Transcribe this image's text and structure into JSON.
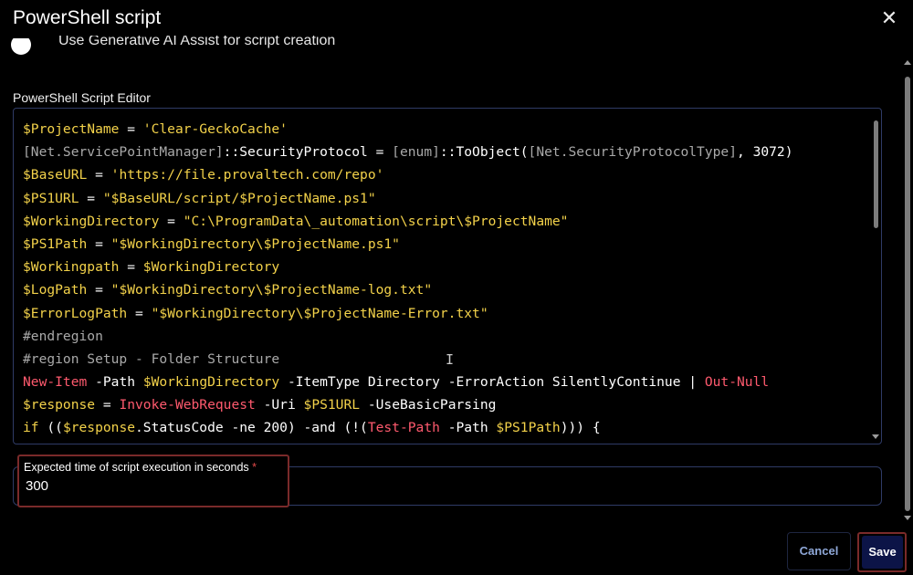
{
  "dialog": {
    "title": "PowerShell script",
    "close_icon": "close-icon"
  },
  "ai_assist": {
    "label": "Use Generative AI Assist for script creation"
  },
  "editor": {
    "label": "PowerShell Script Editor",
    "lines": [
      [
        {
          "c": "v",
          "t": "$ProjectName"
        },
        {
          "c": "p",
          "t": " = "
        },
        {
          "c": "s",
          "t": "'Clear-GeckoCache'"
        }
      ],
      [
        {
          "c": "t",
          "t": "[Net.ServicePointManager]"
        },
        {
          "c": "p",
          "t": "::SecurityProtocol = "
        },
        {
          "c": "t",
          "t": "[enum]"
        },
        {
          "c": "p",
          "t": "::ToObject("
        },
        {
          "c": "t",
          "t": "[Net.SecurityProtocolType]"
        },
        {
          "c": "p",
          "t": ", 3072)"
        }
      ],
      [
        {
          "c": "v",
          "t": "$BaseURL"
        },
        {
          "c": "p",
          "t": " = "
        },
        {
          "c": "s",
          "t": "'https://file.provaltech.com/repo'"
        }
      ],
      [
        {
          "c": "v",
          "t": "$PS1URL"
        },
        {
          "c": "p",
          "t": " = "
        },
        {
          "c": "s",
          "t": "\"$BaseURL/script/$ProjectName.ps1\""
        }
      ],
      [
        {
          "c": "v",
          "t": "$WorkingDirectory"
        },
        {
          "c": "p",
          "t": " = "
        },
        {
          "c": "s",
          "t": "\"C:\\ProgramData\\_automation\\script\\$ProjectName\""
        }
      ],
      [
        {
          "c": "v",
          "t": "$PS1Path"
        },
        {
          "c": "p",
          "t": " = "
        },
        {
          "c": "s",
          "t": "\"$WorkingDirectory\\$ProjectName.ps1\""
        }
      ],
      [
        {
          "c": "v",
          "t": "$Workingpath"
        },
        {
          "c": "p",
          "t": " = "
        },
        {
          "c": "v",
          "t": "$WorkingDirectory"
        }
      ],
      [
        {
          "c": "v",
          "t": "$LogPath"
        },
        {
          "c": "p",
          "t": " = "
        },
        {
          "c": "s",
          "t": "\"$WorkingDirectory\\$ProjectName-log.txt\""
        }
      ],
      [
        {
          "c": "v",
          "t": "$ErrorLogPath"
        },
        {
          "c": "p",
          "t": " = "
        },
        {
          "c": "s",
          "t": "\"$WorkingDirectory\\$ProjectName-Error.txt\""
        }
      ],
      [
        {
          "c": "c",
          "t": "#endregion"
        }
      ],
      [
        {
          "c": "c",
          "t": "#region Setup - Folder Structure"
        }
      ],
      [
        {
          "c": "cmd",
          "t": "New-Item"
        },
        {
          "c": "p",
          "t": " -Path "
        },
        {
          "c": "v",
          "t": "$WorkingDirectory"
        },
        {
          "c": "p",
          "t": " -ItemType Directory -ErrorAction SilentlyContinue | "
        },
        {
          "c": "cmd",
          "t": "Out-Null"
        }
      ],
      [
        {
          "c": "v",
          "t": "$response"
        },
        {
          "c": "p",
          "t": " = "
        },
        {
          "c": "cmd",
          "t": "Invoke-WebRequest"
        },
        {
          "c": "p",
          "t": " -Uri "
        },
        {
          "c": "v",
          "t": "$PS1URL"
        },
        {
          "c": "p",
          "t": " -UseBasicParsing"
        }
      ],
      [
        {
          "c": "s",
          "t": "if"
        },
        {
          "c": "p",
          "t": " (("
        },
        {
          "c": "v",
          "t": "$response"
        },
        {
          "c": "p",
          "t": ".StatusCode -ne 200) -and (!("
        },
        {
          "c": "cmd",
          "t": "Test-Path"
        },
        {
          "c": "p",
          "t": " -Path "
        },
        {
          "c": "v",
          "t": "$PS1Path"
        },
        {
          "c": "p",
          "t": "))) {"
        }
      ]
    ]
  },
  "expected_time": {
    "label": "Expected time of script execution in seconds",
    "required_mark": "*",
    "value": "300"
  },
  "actions": {
    "cancel_label": "Cancel",
    "save_label": "Save"
  }
}
